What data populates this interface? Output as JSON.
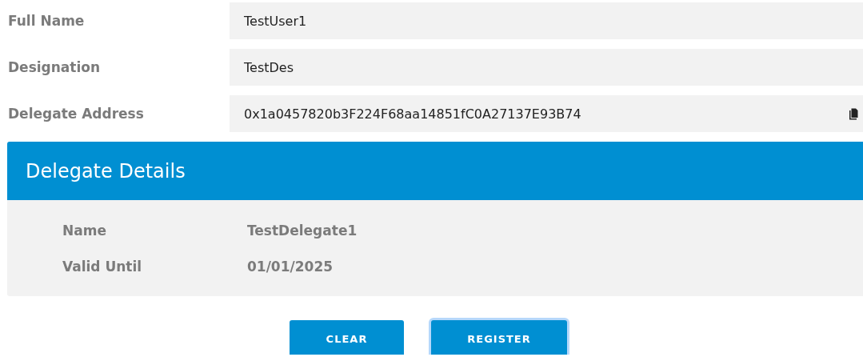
{
  "fields": [
    {
      "label": "Full Name",
      "value": "TestUser1",
      "copyable": false
    },
    {
      "label": "Designation",
      "value": "TestDes",
      "copyable": false
    },
    {
      "label": "Delegate Address",
      "value": "0x1a0457820b3F224F68aa14851fC0A27137E93B74",
      "copyable": true
    }
  ],
  "details": {
    "title": "Delegate Details",
    "rows": [
      {
        "label": "Name",
        "value": "TestDelegate1"
      },
      {
        "label": "Valid Until",
        "value": "01/01/2025"
      }
    ]
  },
  "buttons": [
    {
      "label": "CLEAR",
      "focused": false
    },
    {
      "label": "REGISTER",
      "focused": true
    }
  ]
}
